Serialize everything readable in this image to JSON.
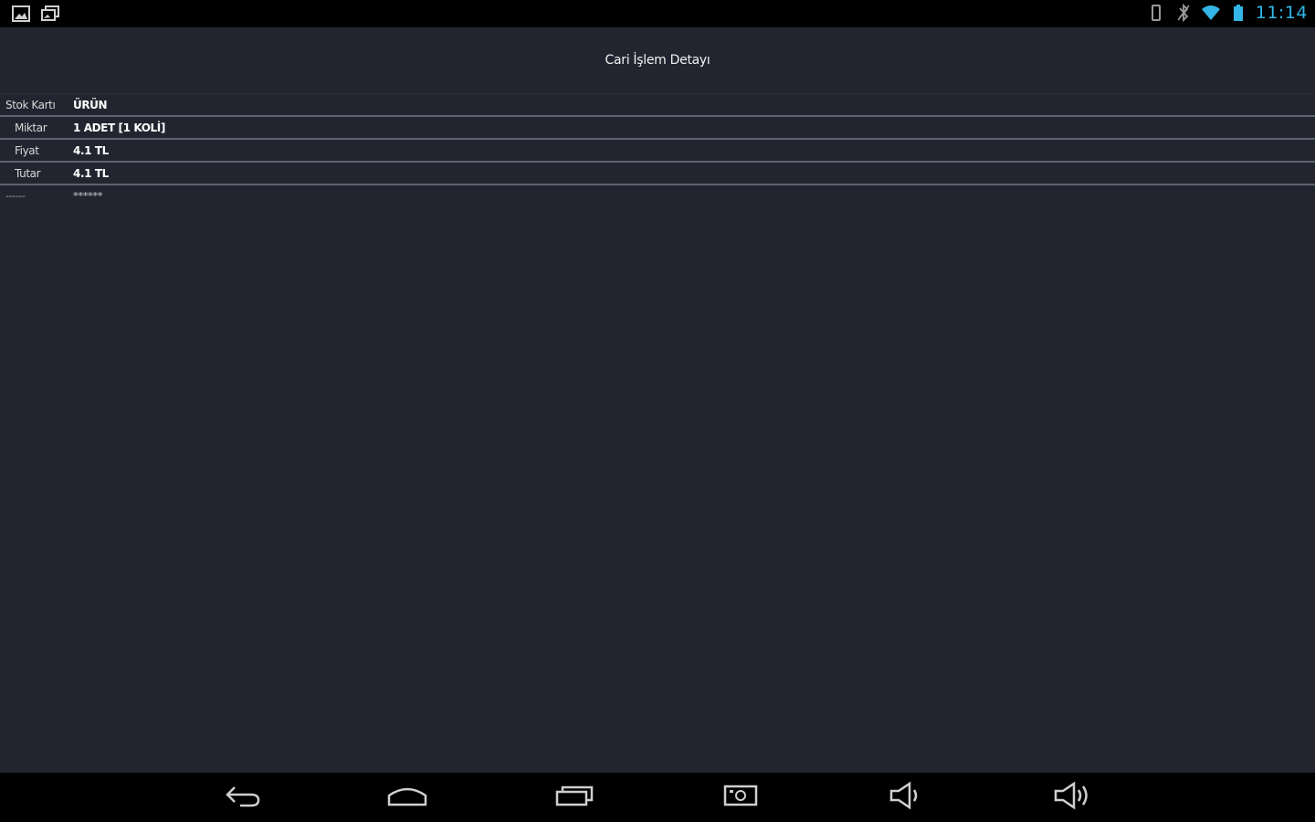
{
  "statusbar": {
    "clock": "11:14",
    "left_icons": [
      "image-icon",
      "gallery-icon"
    ],
    "right_icons": [
      "vibrate-icon",
      "bluetooth-icon",
      "wifi-icon",
      "battery-icon"
    ],
    "accent_color": "#33b5e5"
  },
  "header": {
    "title": "Cari İşlem Detayı"
  },
  "details": [
    {
      "label": "Stok Kartı",
      "value": "ÜRÜN"
    },
    {
      "label": "Miktar",
      "value": "1 ADET [1 KOLİ]"
    },
    {
      "label": "Fiyat",
      "value": "4.1 TL"
    },
    {
      "label": "Tutar",
      "value": "4.1 TL"
    },
    {
      "label": "------",
      "value": "******"
    }
  ],
  "navbar": {
    "buttons": [
      "back-icon",
      "home-icon",
      "recent-apps-icon",
      "screenshot-icon",
      "volume-down-icon",
      "volume-up-icon"
    ]
  },
  "colors": {
    "background": "#22252f",
    "divider": "#5c6270",
    "system_bar": "#000000"
  }
}
